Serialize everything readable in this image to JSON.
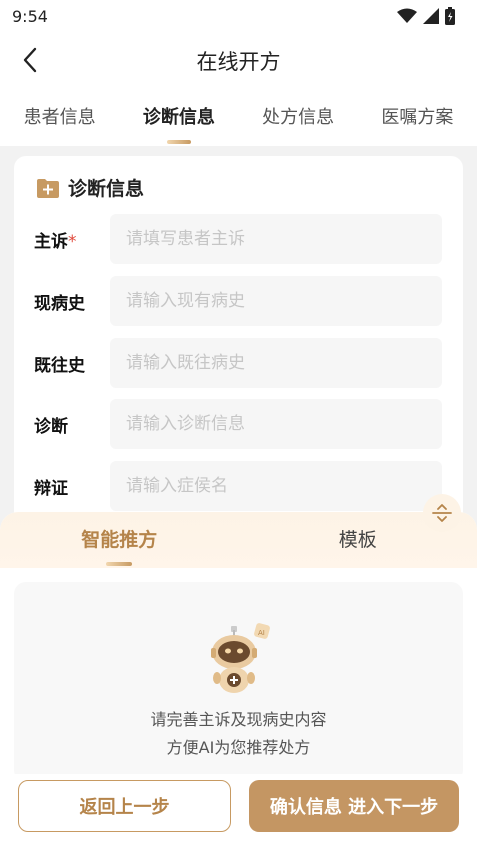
{
  "status": {
    "time": "9:54"
  },
  "header": {
    "title": "在线开方"
  },
  "tabs": [
    {
      "label": "患者信息"
    },
    {
      "label": "诊断信息"
    },
    {
      "label": "处方信息"
    },
    {
      "label": "医嘱方案"
    }
  ],
  "section": {
    "title": "诊断信息"
  },
  "form": [
    {
      "label": "主诉",
      "required_mark": "*",
      "placeholder": "请填写患者主诉",
      "value": ""
    },
    {
      "label": "现病史",
      "placeholder": "请输入现有病史",
      "value": ""
    },
    {
      "label": "既往史",
      "placeholder": "请输入既往病史",
      "value": ""
    },
    {
      "label": "诊断",
      "placeholder": "请输入诊断信息",
      "value": ""
    },
    {
      "label": "辩证",
      "placeholder": "请输入症侯名",
      "value": ""
    }
  ],
  "panel": {
    "tabs": [
      {
        "label": "智能推方"
      },
      {
        "label": "模板"
      }
    ],
    "message_line1": "请完善主诉及现病史内容",
    "message_line2": "方便AI为您推荐处方"
  },
  "footer": {
    "back_label": "返回上一步",
    "next_label": "确认信息 进入下一步"
  },
  "colors": {
    "accent": "#c49663",
    "accent_text": "#b5844a",
    "required": "#e0493b"
  },
  "icons": [
    "back-arrow-icon",
    "wifi-icon",
    "signal-icon",
    "battery-icon",
    "folder-plus-icon",
    "expand-collapse-icon",
    "robot-icon"
  ]
}
